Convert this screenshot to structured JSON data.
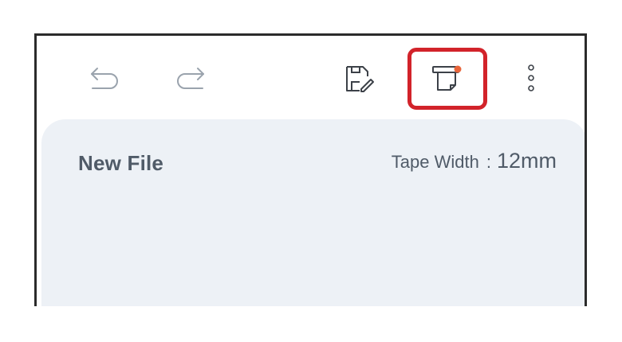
{
  "toolbar": {
    "undo_icon": "undo-arrow-icon",
    "redo_icon": "redo-arrow-icon",
    "save_icon": "save-edit-icon",
    "print_icon": "label-print-icon",
    "more_icon": "more-vertical-icon",
    "highlight_color": "#d2232a",
    "notification_dot_color": "#e8643a"
  },
  "document": {
    "title": "New File",
    "tape_width_label": "Tape Width",
    "tape_width_separator": ":",
    "tape_width_value": "12mm"
  },
  "colors": {
    "card_background": "#edf1f6",
    "text": "#505b68",
    "icon": "#3c4148",
    "icon_disabled": "#9aa3ad"
  }
}
